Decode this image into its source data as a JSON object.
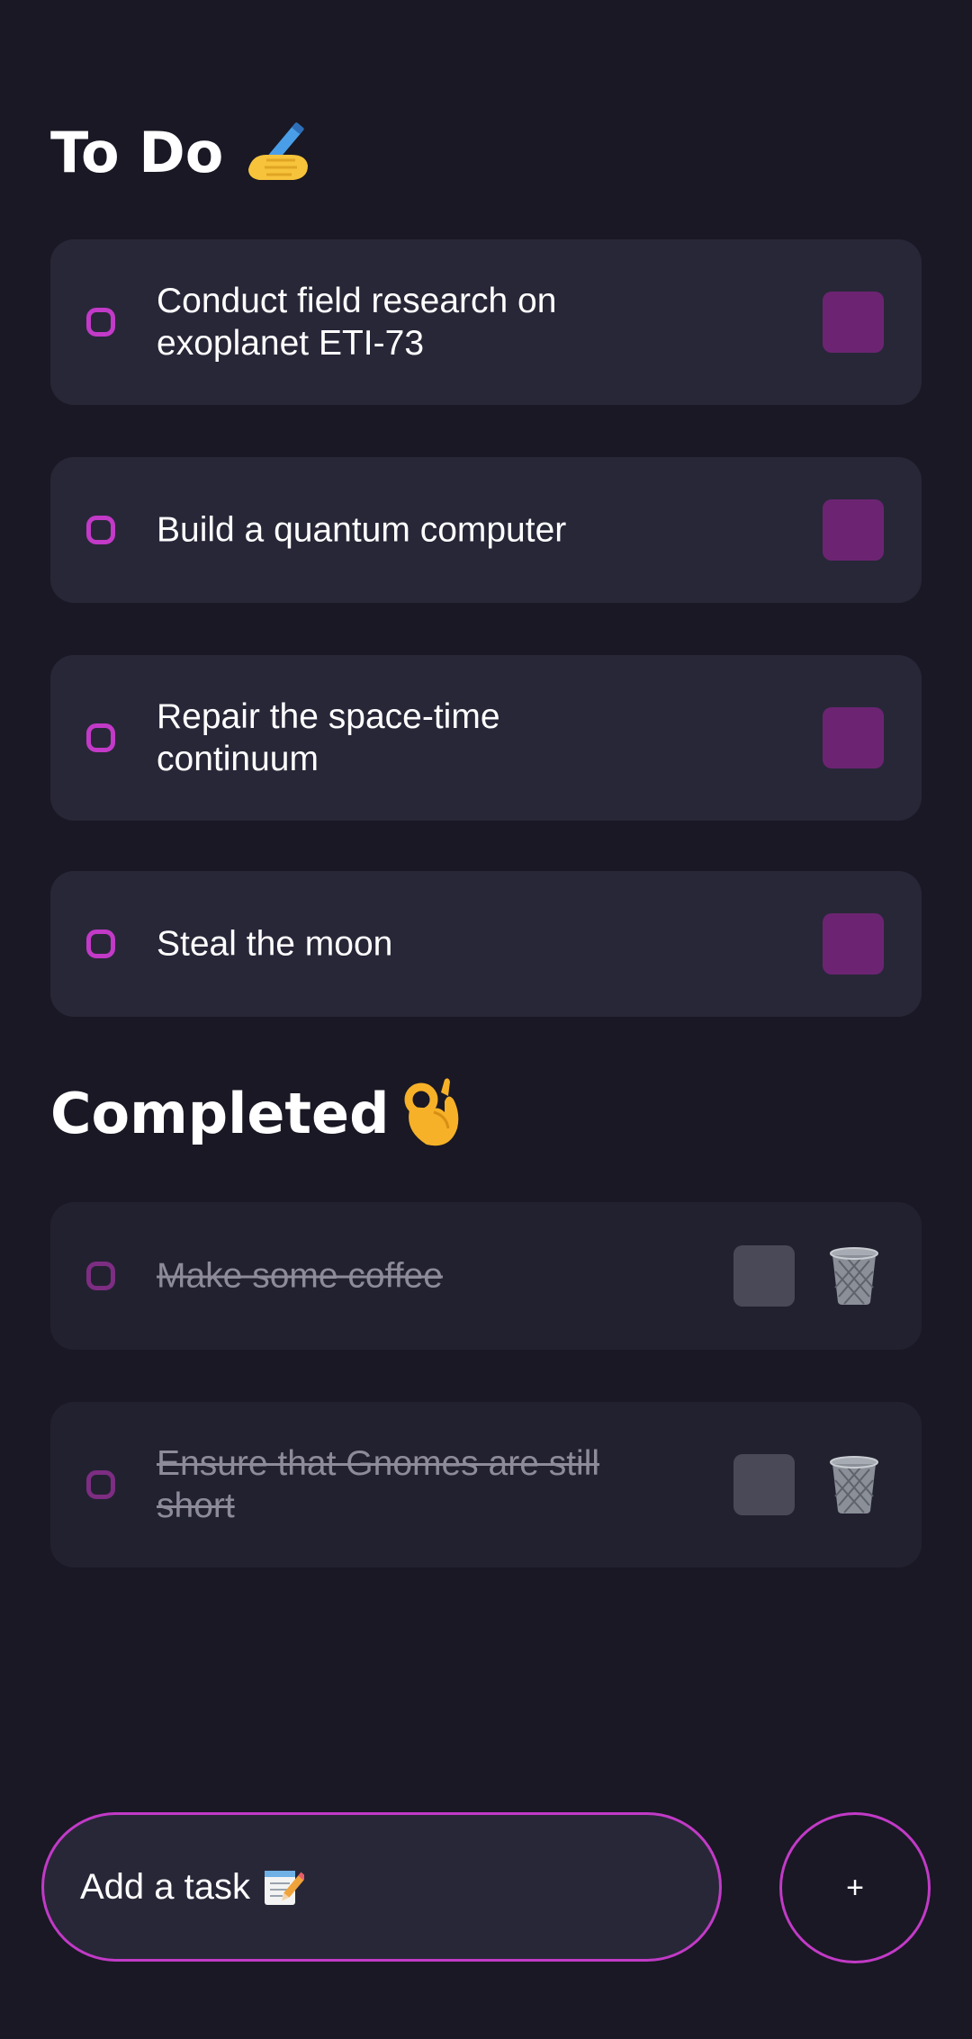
{
  "todo_section": {
    "title": "To Do",
    "emoji": "writing-hand-emoji",
    "tasks": [
      {
        "text": "Conduct field research on exoplanet ETI-73"
      },
      {
        "text": "Build a quantum computer"
      },
      {
        "text": "Repair the space-time continuum"
      },
      {
        "text": "Steal the moon"
      }
    ]
  },
  "completed_section": {
    "title": "Completed",
    "emoji": "ok-hand-emoji",
    "tasks": [
      {
        "text": "Make some coffee"
      },
      {
        "text": "Ensure that Gnomes are still short"
      }
    ]
  },
  "add_task": {
    "placeholder": "Add a task",
    "placeholder_icon": "memo-emoji",
    "button_label": "+"
  },
  "colors": {
    "background": "#191824",
    "card": "#282738",
    "card_completed": "#222130",
    "accent": "#c23ac7",
    "checkbox_todo": "#6c2472",
    "checkbox_done": "#4a4958",
    "completed_text": "#8d8b9a"
  }
}
